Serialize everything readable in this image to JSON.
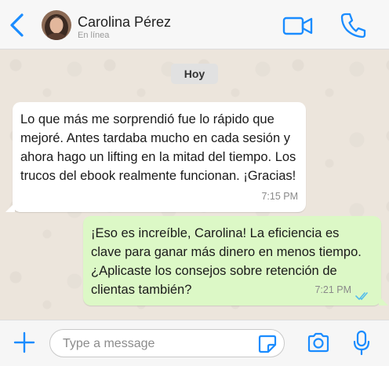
{
  "theme": {
    "accent": "#1a8cff",
    "incoming_bg": "#ffffff",
    "outgoing_bg": "#dcf8c6",
    "read_ticks": "#53bdeb"
  },
  "header": {
    "back_icon": "chevron-left-icon",
    "contact_name": "Carolina Pérez",
    "status": "En línea",
    "video_icon": "video-camera-icon",
    "call_icon": "phone-icon"
  },
  "chat": {
    "date_chip": "Hoy",
    "messages": [
      {
        "direction": "incoming",
        "text": "Lo que más me sorprendió fue lo rápido que mejoré. Antes tardaba mucho en cada sesión y ahora hago un lifting en la mitad del tiempo. Los trucos del ebook realmente funcionan. ¡Gracias!",
        "time": "7:15 PM"
      },
      {
        "direction": "outgoing",
        "text": "¡Eso es increíble, Carolina! La eficiencia es clave para ganar más dinero en menos tiempo. ¿Aplicaste los consejos sobre retención de clientas también?",
        "time": "7:21 PM",
        "status_icon": "double-check-icon"
      }
    ]
  },
  "composer": {
    "placeholder": "Type a message",
    "add_icon": "plus-icon",
    "sticker_icon": "sticker-icon",
    "camera_icon": "camera-icon",
    "mic_icon": "microphone-icon"
  }
}
